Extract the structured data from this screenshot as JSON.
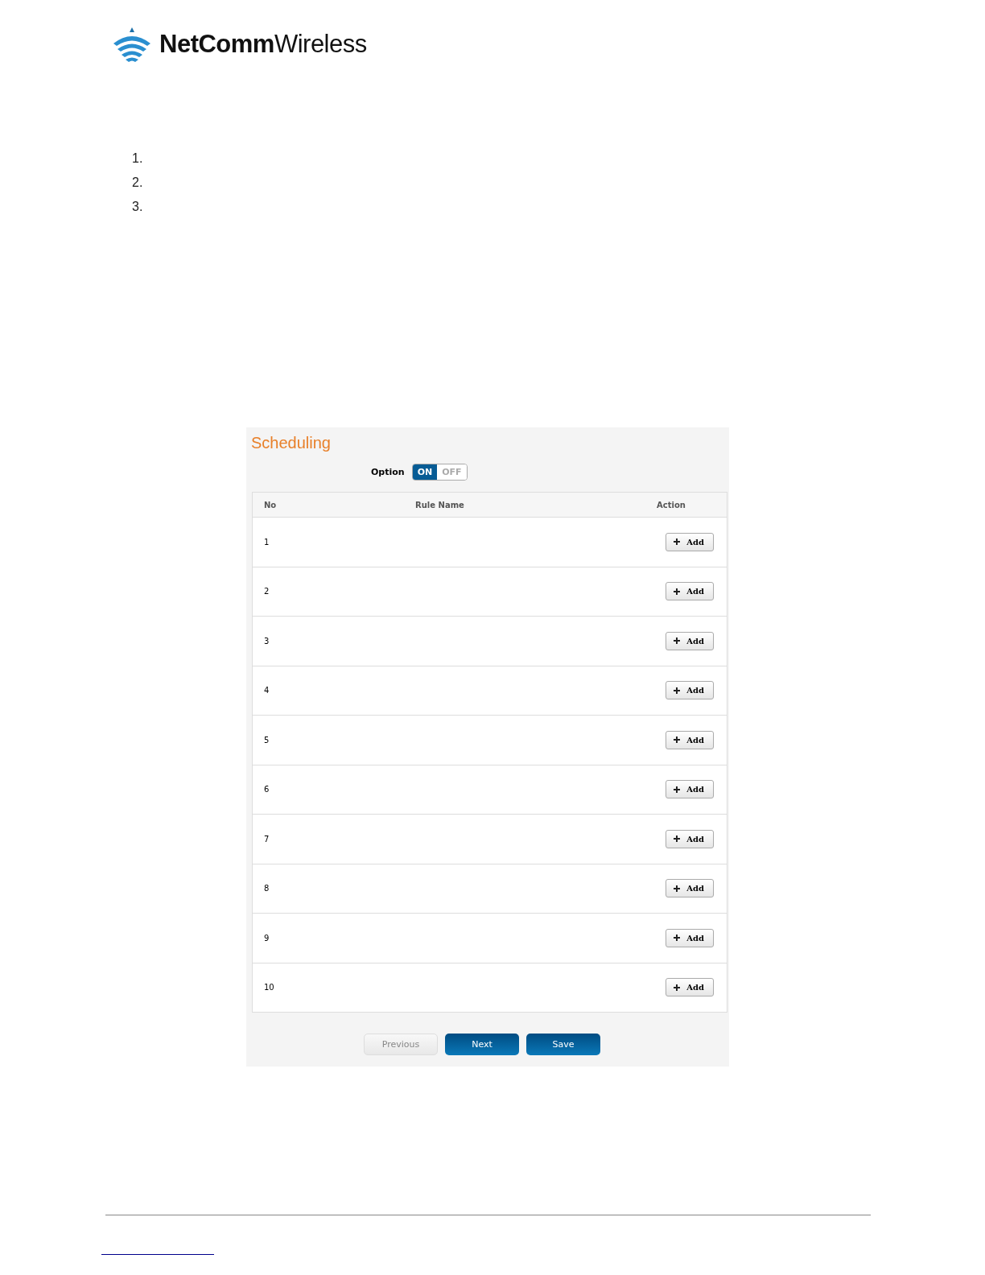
{
  "header": {
    "logo_text": "**NetComm**Wireless"
  },
  "list_numbers": [
    "1.",
    "2.",
    "3."
  ],
  "panel": {
    "title": "Scheduling",
    "option": {
      "label": "Option",
      "on_label": "ON",
      "off_label": "OFF",
      "on": true
    },
    "table": {
      "columns": [
        "No",
        "Rule Name",
        "Action"
      ],
      "rows": [
        {
          "no": "1",
          "action": "Add"
        },
        {
          "no": "2",
          "action": "Add"
        },
        {
          "no": "3",
          "action": "Add"
        },
        {
          "no": "4",
          "action": "Add"
        },
        {
          "no": "5",
          "action": "Add"
        },
        {
          "no": "6",
          "action": "Add"
        },
        {
          "no": "7",
          "action": "Add"
        },
        {
          "no": "8",
          "action": "Add"
        },
        {
          "no": "9",
          "action": "Add"
        },
        {
          "no": "10",
          "action": "Add"
        }
      ]
    },
    "buttons": [
      {
        "label": "Previous",
        "disabled": true
      },
      {
        "label": "Next",
        "disabled": false
      },
      {
        "label": "Save",
        "disabled": false
      }
    ]
  }
}
